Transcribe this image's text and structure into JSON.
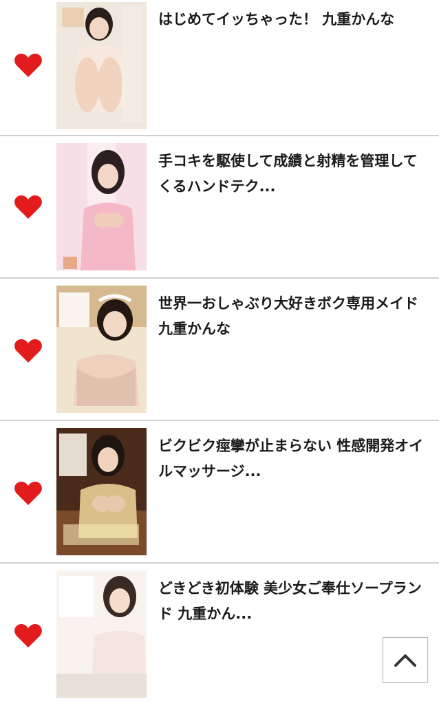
{
  "colors": {
    "heart": "#e21c1c",
    "divider": "#d0d0d0",
    "text": "#1a1a1a"
  },
  "items": [
    {
      "title": "はじめてイッちゃった！ 九重かんな",
      "favorite": true
    },
    {
      "title": "手コキを駆使して成績と射精を管理してくるハンドテク...",
      "favorite": true
    },
    {
      "title": "世界一おしゃぶり大好きボク専用メイド 九重かんな",
      "favorite": true
    },
    {
      "title": "ビクビク痙攣が止まらない 性感開発オイルマッサージ...",
      "favorite": true
    },
    {
      "title": "どきどき初体験 美少女ご奉仕ソープランド 九重かん...",
      "favorite": true
    }
  ],
  "back_to_top_icon": "chevron-up-icon"
}
